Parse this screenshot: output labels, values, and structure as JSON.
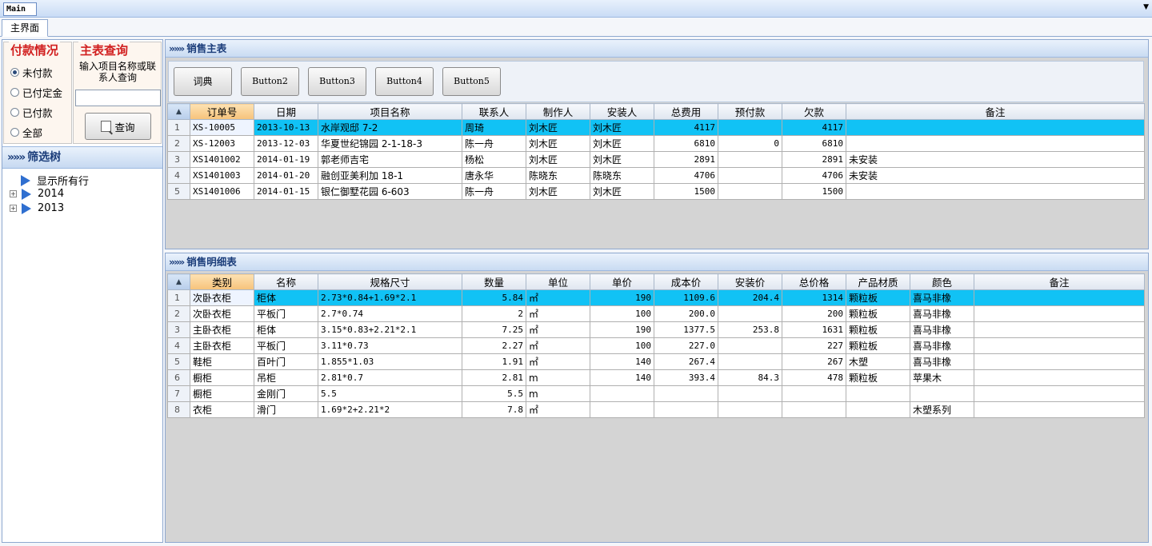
{
  "window": {
    "title": "Main",
    "dropdown_icon": "chevron-down-icon"
  },
  "tabs": [
    {
      "label": "主界面"
    }
  ],
  "payment": {
    "title": "付款情况",
    "options": [
      {
        "label": "未付款",
        "checked": true
      },
      {
        "label": "已付定金",
        "checked": false
      },
      {
        "label": "已付款",
        "checked": false
      },
      {
        "label": "全部",
        "checked": false
      }
    ]
  },
  "query": {
    "title": "主表查询",
    "hint": "输入项目名称或联系人查询",
    "input_value": "",
    "button_label": "查询"
  },
  "tree": {
    "title": "筛选树",
    "nodes": [
      {
        "label": "显示所有行"
      },
      {
        "label": "2014"
      },
      {
        "label": "2013"
      }
    ]
  },
  "main_table": {
    "title": "销售主表",
    "buttons": [
      "词典",
      "Button2",
      "Button3",
      "Button4",
      "Button5"
    ],
    "columns": [
      "订单号",
      "日期",
      "项目名称",
      "联系人",
      "制作人",
      "安装人",
      "总费用",
      "预付款",
      "欠款",
      "备注"
    ],
    "rows": [
      [
        "XS-10005",
        "2013-10-13",
        "水岸观邸 7-2",
        "周琦",
        "刘木匠",
        "刘木匠",
        "4117",
        "",
        "4117",
        ""
      ],
      [
        "XS-12003",
        "2013-12-03",
        "华夏世纪锦园 2-1-18-3",
        "陈一舟",
        "刘木匠",
        "刘木匠",
        "6810",
        "0",
        "6810",
        ""
      ],
      [
        "XS1401002",
        "2014-01-19",
        "郭老师吉宅",
        "杨松",
        "刘木匠",
        "刘木匠",
        "2891",
        "",
        "2891",
        "未安装"
      ],
      [
        "XS1401003",
        "2014-01-20",
        "融创亚美利加 18-1",
        "唐永华",
        "陈晓东",
        "陈晓东",
        "4706",
        "",
        "4706",
        "未安装"
      ],
      [
        "XS1401006",
        "2014-01-15",
        "银仁御墅花园 6-603",
        "陈一舟",
        "刘木匠",
        "刘木匠",
        "1500",
        "",
        "1500",
        ""
      ]
    ]
  },
  "detail_table": {
    "title": "销售明细表",
    "columns": [
      "类别",
      "名称",
      "规格尺寸",
      "数量",
      "单位",
      "单价",
      "成本价",
      "安装价",
      "总价格",
      "产品材质",
      "颜色",
      "备注"
    ],
    "rows": [
      [
        "次卧衣柜",
        "柜体",
        "2.73*0.84+1.69*2.1",
        "5.84",
        "㎡",
        "190",
        "1109.6",
        "204.4",
        "1314",
        "颗粒板",
        "喜马非橡",
        ""
      ],
      [
        "次卧衣柜",
        "平板门",
        "2.7*0.74",
        "2",
        "㎡",
        "100",
        "200.0",
        "",
        "200",
        "颗粒板",
        "喜马非橡",
        ""
      ],
      [
        "主卧衣柜",
        "柜体",
        "3.15*0.83+2.21*2.1",
        "7.25",
        "㎡",
        "190",
        "1377.5",
        "253.8",
        "1631",
        "颗粒板",
        "喜马非橡",
        ""
      ],
      [
        "主卧衣柜",
        "平板门",
        "3.11*0.73",
        "2.27",
        "㎡",
        "100",
        "227.0",
        "",
        "227",
        "颗粒板",
        "喜马非橡",
        ""
      ],
      [
        "鞋柜",
        "百叶门",
        "1.855*1.03",
        "1.91",
        "㎡",
        "140",
        "267.4",
        "",
        "267",
        "木塑",
        "喜马非橡",
        ""
      ],
      [
        "橱柜",
        "吊柜",
        "2.81*0.7",
        "2.81",
        "m",
        "140",
        "393.4",
        "84.3",
        "478",
        "颗粒板",
        "苹果木",
        ""
      ],
      [
        "橱柜",
        "金刚门",
        "5.5",
        "5.5",
        "m",
        "",
        "",
        "",
        "",
        "",
        "",
        ""
      ],
      [
        "衣柜",
        "滑门",
        "1.69*2+2.21*2",
        "7.8",
        "㎡",
        "",
        "",
        "",
        "",
        "",
        "木塑系列",
        ""
      ]
    ]
  },
  "colors": {
    "selected_row": "#11c2f5",
    "group_title": "#d11f1f",
    "header_text": "#1b3d7a"
  }
}
